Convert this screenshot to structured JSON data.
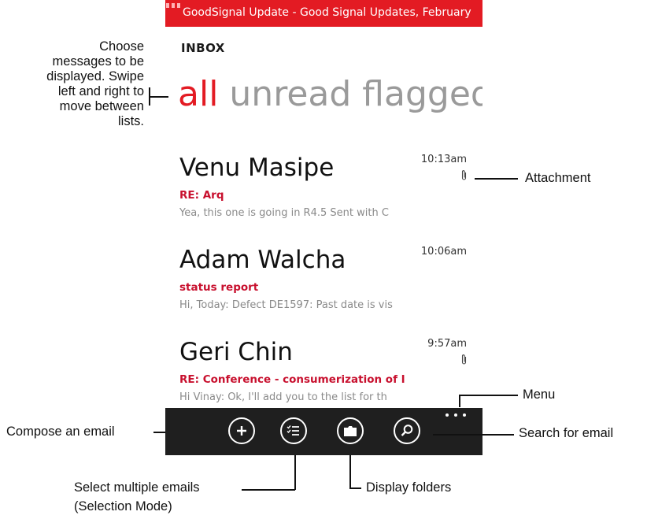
{
  "notification": {
    "text": "GoodSignal Update - Good Signal Updates, February"
  },
  "inbox": {
    "title": "INBOX",
    "pivots": [
      {
        "label": "all",
        "active": true
      },
      {
        "label": "unread",
        "active": false
      },
      {
        "label": "flagged",
        "active": false
      }
    ],
    "messages": [
      {
        "from": "Venu Masipe",
        "time": "10:13am",
        "attachment": true,
        "subject": "RE: Arq",
        "preview": "Yea, this one is going in R4.5 Sent with C"
      },
      {
        "from": "Adam Walcha",
        "time": "10:06am",
        "attachment": false,
        "subject": "status report",
        "preview": "Hi, Today: Defect DE1597: Past date is vis"
      },
      {
        "from": "Geri Chin",
        "time": "9:57am",
        "attachment": true,
        "subject": "RE: Conference - consumerization of I",
        "preview": "Hi Vinay: Ok, I'll add you to the list for th"
      }
    ]
  },
  "appbar": {
    "buttons": [
      {
        "icon": "add-icon"
      },
      {
        "icon": "select-list-icon"
      },
      {
        "icon": "folder-icon"
      },
      {
        "icon": "search-icon"
      }
    ],
    "menu_icon": "ellipsis-icon"
  },
  "callouts": {
    "choose": "Choose messages to be displayed. Swipe left and right to move between lists.",
    "choose_lines": [
      "Choose",
      "messages to be",
      "displayed. Swipe",
      "left and right to",
      "move between",
      "lists."
    ],
    "attachment": "Attachment",
    "menu": "Menu",
    "compose": "Compose an email",
    "search": "Search for email",
    "select_line1": "Select multiple emails",
    "select_line2": "(Selection Mode)",
    "folders": "Display folders"
  },
  "colors": {
    "accent": "#e31b23",
    "subject": "#c8102e",
    "appbar": "#1f1f1f"
  }
}
